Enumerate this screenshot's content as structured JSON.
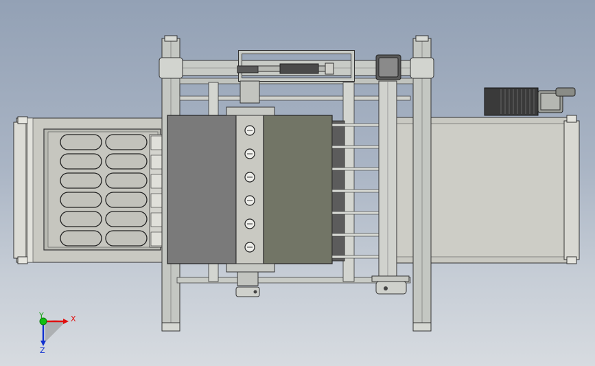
{
  "viewport": {
    "background_top": "#93a1b5",
    "background_bottom": "#d7dbe0"
  },
  "triad": {
    "x_label": "X",
    "y_label": "Y",
    "z_label": "Z",
    "x_color": "#e01010",
    "y_color": "#10c010",
    "z_color": "#1030d0"
  },
  "model": {
    "belt_color": "#c9c9c2",
    "frame_color": "#c4c7c2",
    "dark_plate_color": "#7a7a7a",
    "olive_plate_color": "#727566",
    "motor_color": "#3a3a3a",
    "tray_rows": 6,
    "tray_columns": 2,
    "screw_count": 6
  }
}
